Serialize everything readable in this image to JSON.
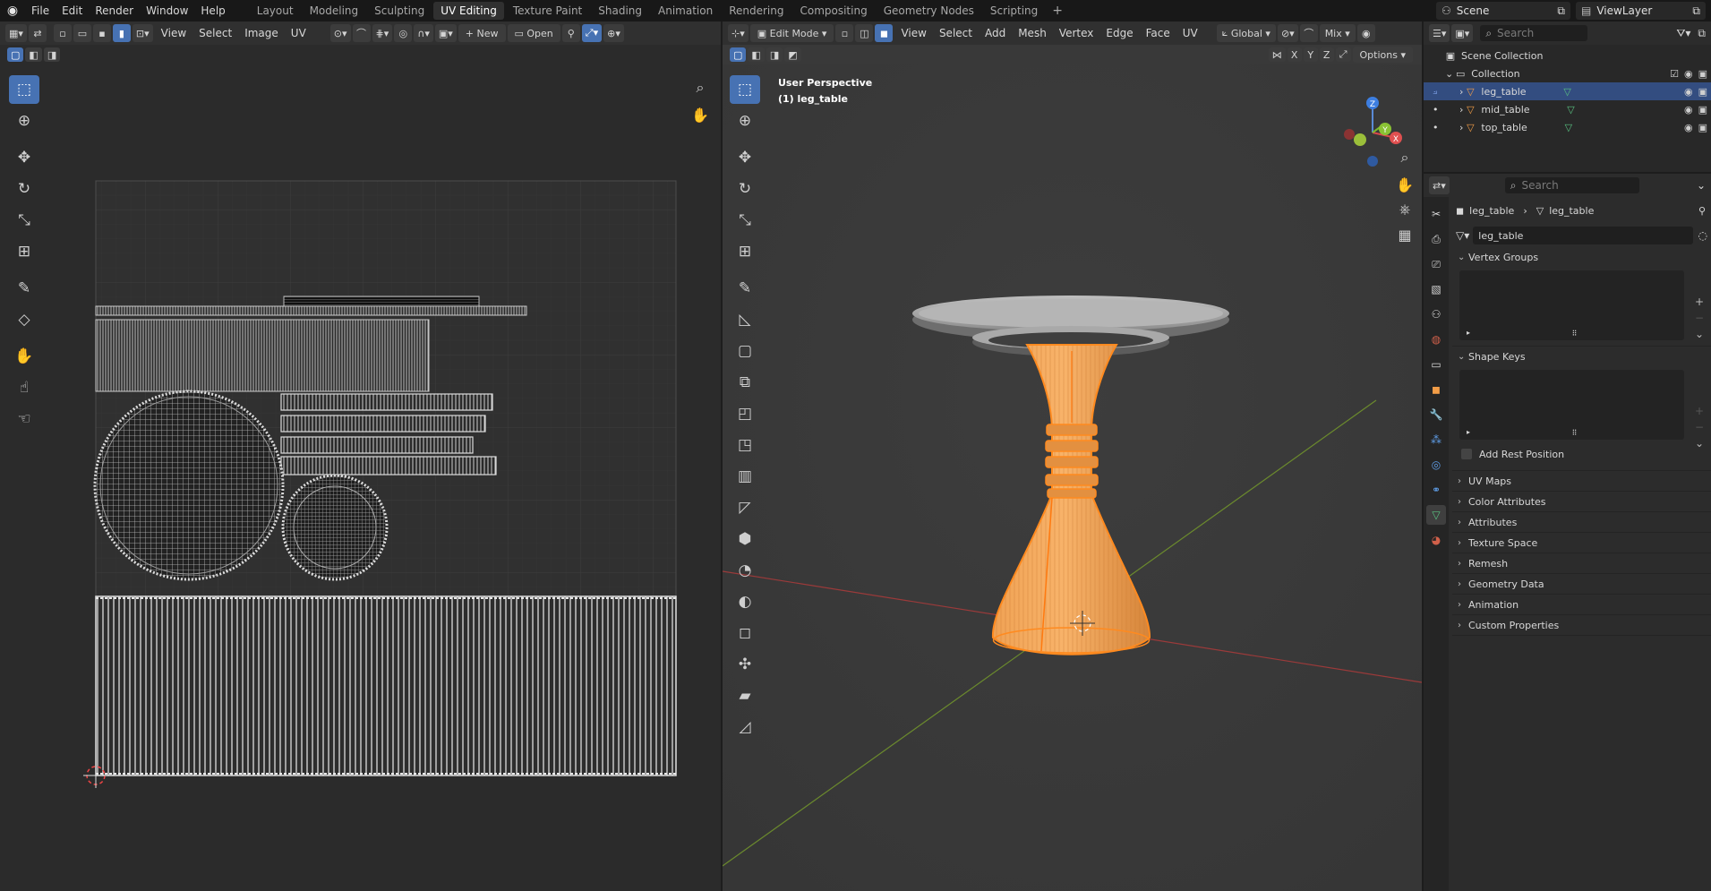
{
  "menu": [
    "File",
    "Edit",
    "Render",
    "Window",
    "Help"
  ],
  "workspaces": [
    {
      "label": "Layout",
      "active": false
    },
    {
      "label": "Modeling",
      "active": false
    },
    {
      "label": "Sculpting",
      "active": false
    },
    {
      "label": "UV Editing",
      "active": true
    },
    {
      "label": "Texture Paint",
      "active": false
    },
    {
      "label": "Shading",
      "active": false
    },
    {
      "label": "Animation",
      "active": false
    },
    {
      "label": "Rendering",
      "active": false
    },
    {
      "label": "Compositing",
      "active": false
    },
    {
      "label": "Geometry Nodes",
      "active": false
    },
    {
      "label": "Scripting",
      "active": false
    }
  ],
  "scene_name": "Scene",
  "view_layer_name": "ViewLayer",
  "uv_editor": {
    "menus": [
      "View",
      "Select",
      "Image",
      "UV"
    ],
    "new_label": "New",
    "open_label": "Open"
  },
  "viewport": {
    "mode_label": "Edit Mode",
    "menus": [
      "View",
      "Select",
      "Add",
      "Mesh",
      "Vertex",
      "Edge",
      "Face",
      "UV"
    ],
    "orientation_label": "Global",
    "mix_label": "Mix",
    "axis_x": "X",
    "axis_y": "Y",
    "axis_z": "Z",
    "options_label": "Options",
    "info_line1": "User Perspective",
    "info_line2": "(1) leg_table",
    "gizmo_x": "X",
    "gizmo_y": "Y",
    "gizmo_z": "Z"
  },
  "outliner": {
    "search_placeholder": "Search",
    "scene_collection": "Scene Collection",
    "collection": "Collection",
    "objects": [
      "leg_table",
      "mid_table",
      "top_table"
    ]
  },
  "properties": {
    "search_placeholder": "Search",
    "breadcrumb_object": "leg_table",
    "breadcrumb_data": "leg_table",
    "data_name": "leg_table",
    "panels": {
      "vertex_groups": "Vertex Groups",
      "shape_keys": "Shape Keys",
      "add_rest_position": "Add Rest Position",
      "uv_maps": "UV Maps",
      "color_attributes": "Color Attributes",
      "attributes": "Attributes",
      "texture_space": "Texture Space",
      "remesh": "Remesh",
      "geometry_data": "Geometry Data",
      "animation": "Animation",
      "custom_properties": "Custom Properties"
    }
  },
  "colors": {
    "accent_blue": "#4772b3",
    "selection_orange": "#f29d47",
    "mesh_data_green": "#59c181"
  }
}
